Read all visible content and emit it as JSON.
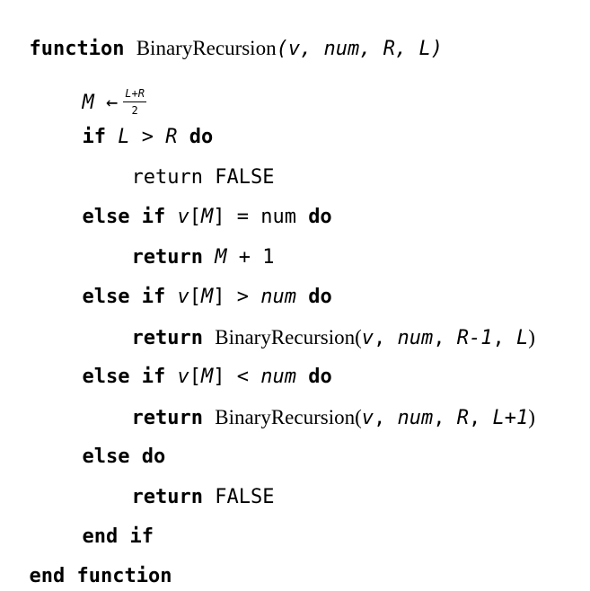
{
  "algorithm": {
    "kw_function": "function",
    "function_name": "BinaryRecursion",
    "params": "(v, num, R, L)",
    "m_var": "M",
    "arrow": "←",
    "frac_num": "L+R",
    "frac_den": "2",
    "kw_if": "if",
    "cond1_l": "L",
    "cond1_op": " > ",
    "cond1_r": "R",
    "kw_do": "do",
    "return_false_text": "return FALSE",
    "kw_else_if": "else if",
    "cond2_v": "v",
    "cond2_m": "M",
    "cond2_rest": "] = num ",
    "kw_return": "return",
    "ret2_m": "M",
    "ret2_rest": " + 1",
    "cond3_v": "v",
    "cond3_m": "M",
    "cond3_op": "] > ",
    "cond3_num": "num",
    "call3_args_v": "v",
    "call3_args_num": "num",
    "call3_args_r": "R-1",
    "call3_args_l": "L",
    "cond4_v": "v",
    "cond4_m": "M",
    "cond4_op": "] < ",
    "cond4_num": "num",
    "call4_args_v": "v",
    "call4_args_num": "num",
    "call4_args_r": "R",
    "call4_args_l": "L+1",
    "kw_else_do": "else do",
    "false_text": "FALSE",
    "kw_end_if": "end if",
    "kw_end_function": "end function"
  }
}
